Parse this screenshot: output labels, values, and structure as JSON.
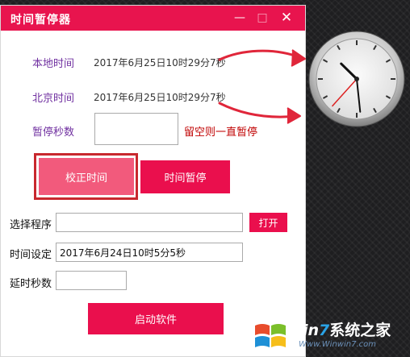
{
  "window": {
    "title": "时间暂停器",
    "controls": {
      "minimize": "—",
      "maximize": "□",
      "close": "✕"
    }
  },
  "local_time": {
    "label": "本地时间",
    "value": "2017年6月25日10时29分7秒"
  },
  "beijing_time": {
    "label": "北京时间",
    "value": "2017年6月25日10时29分7秒"
  },
  "pause_seconds": {
    "label": "暂停秒数",
    "value": "",
    "note": "留空则一直暂停"
  },
  "buttons": {
    "calibrate": "校正时间",
    "pause": "时间暂停",
    "open": "打开",
    "launch": "启动软件"
  },
  "program": {
    "label": "选择程序",
    "value": ""
  },
  "time_setting": {
    "label": "时间设定",
    "value": "2017年6月24日10时5分5秒"
  },
  "delay_seconds": {
    "label": "延时秒数",
    "value": ""
  },
  "clock": {
    "hour": 10,
    "minute": 29,
    "second": 37
  },
  "watermark": {
    "brand_prefix": "Win",
    "brand_digit": "7",
    "brand_cn": "系统之家",
    "url": "Www.Winwin7.com"
  },
  "colors": {
    "accent": "#ea0f4d",
    "label_purple": "#7030a0",
    "note_red": "#c00000",
    "arrow_red": "#e0263a"
  },
  "icons": [
    "minimize-icon",
    "maximize-icon",
    "close-icon",
    "arrow-icon",
    "clock-icon",
    "windows-logo-icon"
  ]
}
